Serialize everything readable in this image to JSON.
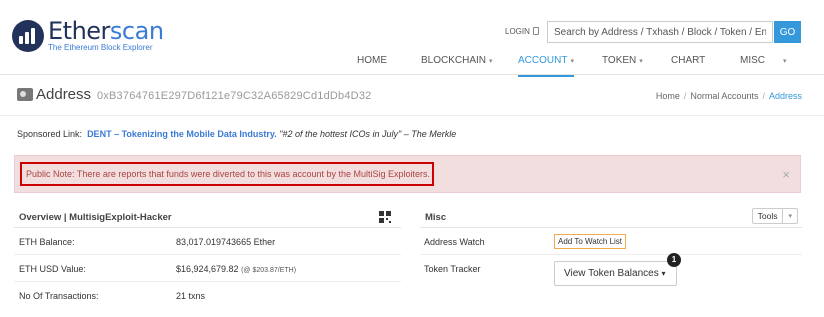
{
  "header": {
    "brand_name_1": "Ether",
    "brand_name_2": "scan",
    "brand_sub": "The Ethereum Block Explorer",
    "login_label": "LOGIN",
    "search_placeholder": "Search by Address / Txhash / Block / Token / Ens",
    "go_label": "GO",
    "nav": [
      {
        "label": "HOME",
        "caret": false,
        "active": false
      },
      {
        "label": "BLOCKCHAIN",
        "caret": true,
        "active": false
      },
      {
        "label": "ACCOUNT",
        "caret": true,
        "active": true
      },
      {
        "label": "TOKEN",
        "caret": true,
        "active": false
      },
      {
        "label": "CHART",
        "caret": false,
        "active": false
      },
      {
        "label": "MISC",
        "caret": true,
        "active": false
      }
    ],
    "accent_color": "#3498db"
  },
  "address_bar": {
    "title": "Address",
    "hash": "0xB3764761E297D6f121e79C32A65829Cd1dDb4D32",
    "breadcrumb": [
      "Home",
      "Normal Accounts",
      "Address"
    ]
  },
  "sponsored": {
    "label": "Sponsored Link:",
    "link": "DENT – Tokenizing the Mobile Data Industry.",
    "quote": "\"#2 of the hottest ICOs in July\" – The Merkle"
  },
  "alert": {
    "text": "Public Note: There are reports that funds were diverted to this was account by the MultiSig Exploiters.",
    "close": "×"
  },
  "overview": {
    "title": "Overview | MultisigExploit-Hacker",
    "rows": [
      {
        "label": "ETH Balance:",
        "value": "83,017.019743665 Ether",
        "note": ""
      },
      {
        "label": "ETH USD Value:",
        "value": "$16,924,679.82",
        "note": "(@ $203.87/ETH)"
      },
      {
        "label": "No Of Transactions:",
        "value": "21 txns",
        "note": ""
      }
    ]
  },
  "misc": {
    "title": "Misc",
    "tools_label": "Tools",
    "watch_label": "Address Watch",
    "watch_button": "Add To Watch List",
    "tracker_label": "Token Tracker",
    "token_button": "View Token Balances",
    "token_badge": "1"
  }
}
